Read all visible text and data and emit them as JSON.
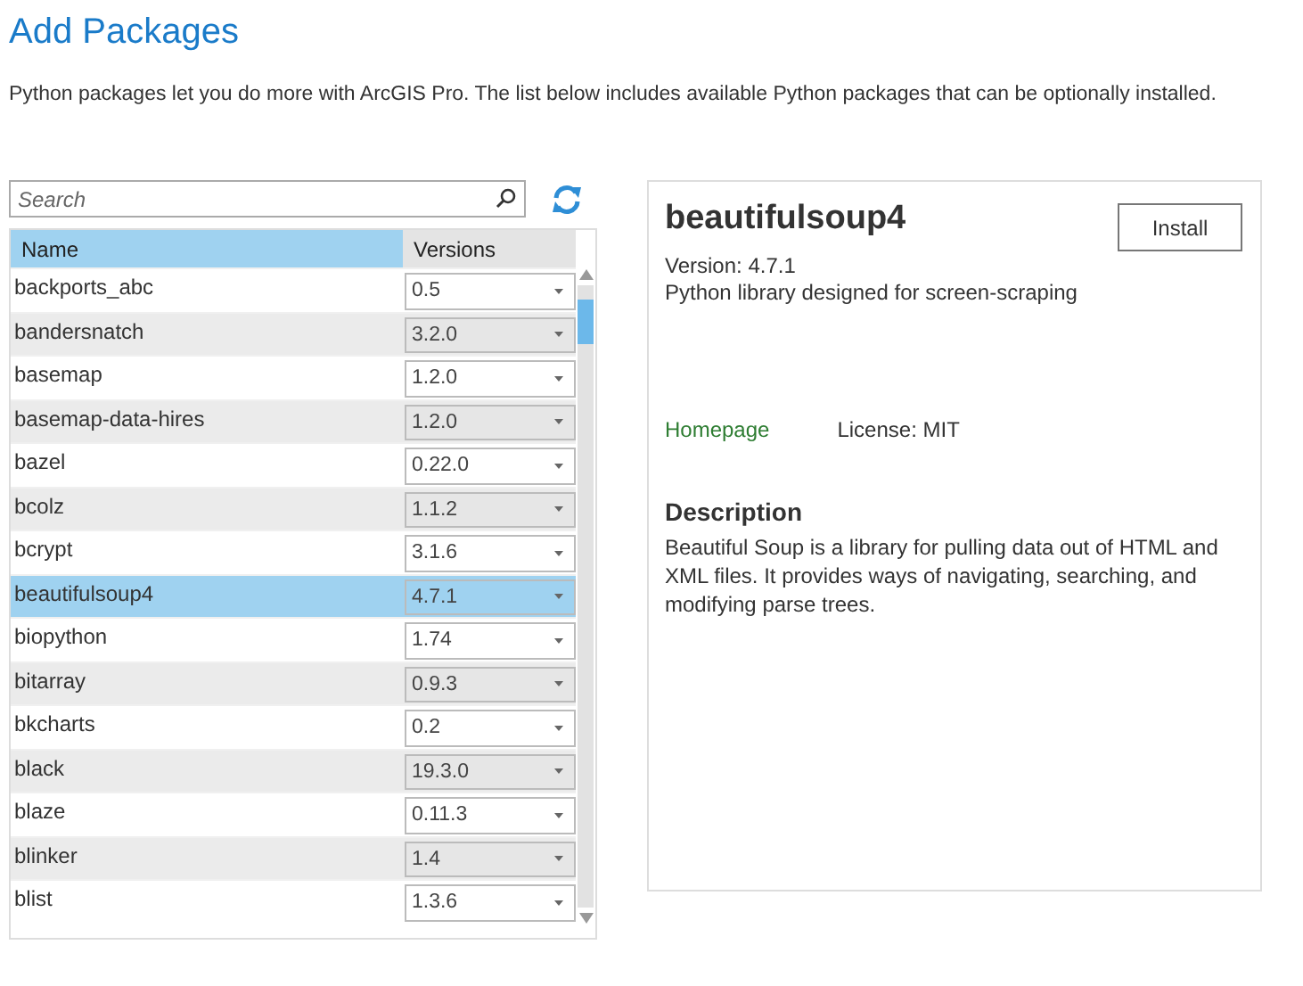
{
  "title": "Add Packages",
  "intro": "Python packages let you do more with ArcGIS Pro. The list below includes available Python packages that can be optionally installed.",
  "search": {
    "placeholder": "Search"
  },
  "table": {
    "columns": [
      "Name",
      "Versions"
    ],
    "rows": [
      {
        "name": "backports_abc",
        "version": "0.5",
        "selected": false
      },
      {
        "name": "bandersnatch",
        "version": "3.2.0",
        "selected": false
      },
      {
        "name": "basemap",
        "version": "1.2.0",
        "selected": false
      },
      {
        "name": "basemap-data-hires",
        "version": "1.2.0",
        "selected": false
      },
      {
        "name": "bazel",
        "version": "0.22.0",
        "selected": false
      },
      {
        "name": "bcolz",
        "version": "1.1.2",
        "selected": false
      },
      {
        "name": "bcrypt",
        "version": "3.1.6",
        "selected": false
      },
      {
        "name": "beautifulsoup4",
        "version": "4.7.1",
        "selected": true
      },
      {
        "name": "biopython",
        "version": "1.74",
        "selected": false
      },
      {
        "name": "bitarray",
        "version": "0.9.3",
        "selected": false
      },
      {
        "name": "bkcharts",
        "version": "0.2",
        "selected": false
      },
      {
        "name": "black",
        "version": "19.3.0",
        "selected": false
      },
      {
        "name": "blaze",
        "version": "0.11.3",
        "selected": false
      },
      {
        "name": "blinker",
        "version": "1.4",
        "selected": false
      },
      {
        "name": "blist",
        "version": "1.3.6",
        "selected": false
      }
    ]
  },
  "details": {
    "name": "beautifulsoup4",
    "button": "Install",
    "version": "Version: 4.7.1",
    "summary": "Python library designed for screen-scraping",
    "homepage": "Homepage",
    "license": "License: MIT",
    "description_heading": "Description",
    "description": "Beautiful Soup is a library for pulling data out of HTML and XML files. It provides ways of navigating, searching, and modifying parse trees."
  }
}
